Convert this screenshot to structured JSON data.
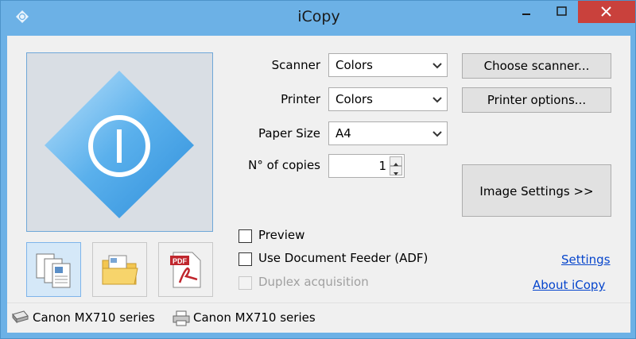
{
  "window": {
    "title": "iCopy"
  },
  "colors": {
    "titlebar": "#6cb1e6",
    "close_button": "#c9413c",
    "link": "#0645cc",
    "selected_tile": "#d5e8f8"
  },
  "form": {
    "scanner_label": "Scanner",
    "scanner_value": "Colors",
    "printer_label": "Printer",
    "printer_value": "Colors",
    "paper_label": "Paper Size",
    "paper_value": "A4",
    "copies_label": "N° of copies",
    "copies_value": "1"
  },
  "buttons": {
    "choose_scanner": "Choose scanner...",
    "printer_options": "Printer options...",
    "image_settings": "Image Settings >>"
  },
  "options": {
    "preview": "Preview",
    "feeder": "Use Document Feeder (ADF)",
    "duplex": "Duplex acquisition"
  },
  "links": {
    "settings": "Settings",
    "about": "About iCopy"
  },
  "mode_tiles": {
    "copy_icon": "copy-documents-icon",
    "folder_icon": "folder-icon",
    "pdf_icon": "pdf-icon",
    "pdf_badge": "PDF"
  },
  "status": {
    "scanner_name": "Canon MX710 series",
    "printer_name": "Canon MX710 series"
  }
}
